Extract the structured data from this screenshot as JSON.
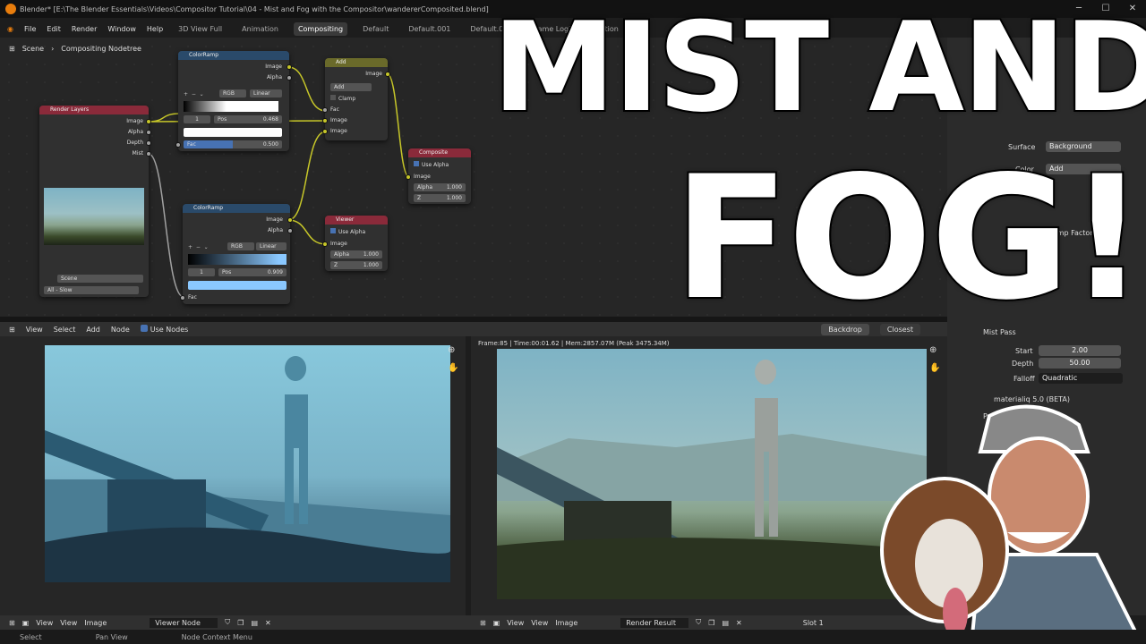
{
  "window": {
    "title": "Blender* [E:\\The Blender Essentials\\Videos\\Compositor Tutorial\\04 - Mist and Fog with the Compositor\\wandererComposited.blend]"
  },
  "menu": [
    "File",
    "Edit",
    "Render",
    "Window",
    "Help"
  ],
  "workspaces": [
    "3D View Full",
    "Animation",
    "Compositing",
    "Default",
    "Default.001",
    "Default.002",
    "Game Logic",
    "Motion"
  ],
  "active_workspace": "Compositing",
  "breadcrumb": {
    "scene": "Scene",
    "tree": "Compositing Nodetree"
  },
  "nodes": {
    "colorramp1": {
      "title": "ColorRamp",
      "out_image": "Image",
      "out_alpha": "Alpha",
      "mode": "RGB",
      "interp": "Linear",
      "index": "1",
      "pos_label": "Pos",
      "pos": "0.468",
      "fac_label": "Fac",
      "fac": "0.500"
    },
    "add": {
      "title": "Add",
      "out_image": "Image",
      "blend": "Add",
      "clamp": "Clamp",
      "fac": "Fac",
      "in1": "Image",
      "in2": "Image"
    },
    "render_layers": {
      "title": "Render Layers",
      "out_image": "Image",
      "out_alpha": "Alpha",
      "out_depth": "Depth",
      "out_mist": "Mist",
      "scene": "Scene",
      "layer": "All - Slow"
    },
    "composite": {
      "title": "Composite",
      "use_alpha": "Use Alpha",
      "image": "Image",
      "alpha_label": "Alpha",
      "alpha": "1.000",
      "z_label": "Z",
      "z": "1.000"
    },
    "colorramp2": {
      "title": "ColorRamp",
      "out_image": "Image",
      "out_alpha": "Alpha",
      "mode": "RGB",
      "interp": "Linear",
      "index": "1",
      "pos_label": "Pos",
      "pos": "0.909",
      "fac_label": "Fac"
    },
    "viewer": {
      "title": "Viewer",
      "use_alpha": "Use Alpha",
      "image": "Image",
      "alpha_label": "Alpha",
      "alpha": "1.000",
      "z_label": "Z",
      "z": "1.000"
    }
  },
  "node_header": {
    "view": "View",
    "select": "Select",
    "add": "Add",
    "node": "Node",
    "use_nodes": "Use Nodes",
    "backdrop": "Backdrop",
    "closest": "Closest"
  },
  "frame_info": "Frame:85 | Time:00:01.62 | Mem:2857.07M (Peak 3475.34M)",
  "left_footer": {
    "view1": "View",
    "view2": "View",
    "image": "Image",
    "node_name": "Viewer Node"
  },
  "right_footer": {
    "view1": "View",
    "view2": "View",
    "image": "Image",
    "node_name": "Render Result",
    "slot": "Slot 1"
  },
  "status": {
    "select": "Select",
    "pan": "Pan View",
    "context": "Node Context Menu"
  },
  "properties": {
    "surface_label": "Surface",
    "surface": "Background",
    "color_label": "Color",
    "color": "Add",
    "clamp_factor": "Clamp Factor",
    "mist_pass": "Mist Pass",
    "start_label": "Start",
    "start": "2.00",
    "depth_label": "Depth",
    "depth": "50.00",
    "falloff_label": "Falloff",
    "falloff": "Quadratic",
    "addon": "materialiq 5.0 (BETA)",
    "pro": "Pro"
  },
  "overlay": {
    "line1": "MIST AND",
    "line2": "FOG!"
  },
  "colors": {
    "accent": "#e87d0d",
    "socket_yellow": "#c7c729",
    "header_add": "#6a6a2a",
    "header_rl": "#8a2a3a",
    "header_color": "#2a4a6a"
  }
}
